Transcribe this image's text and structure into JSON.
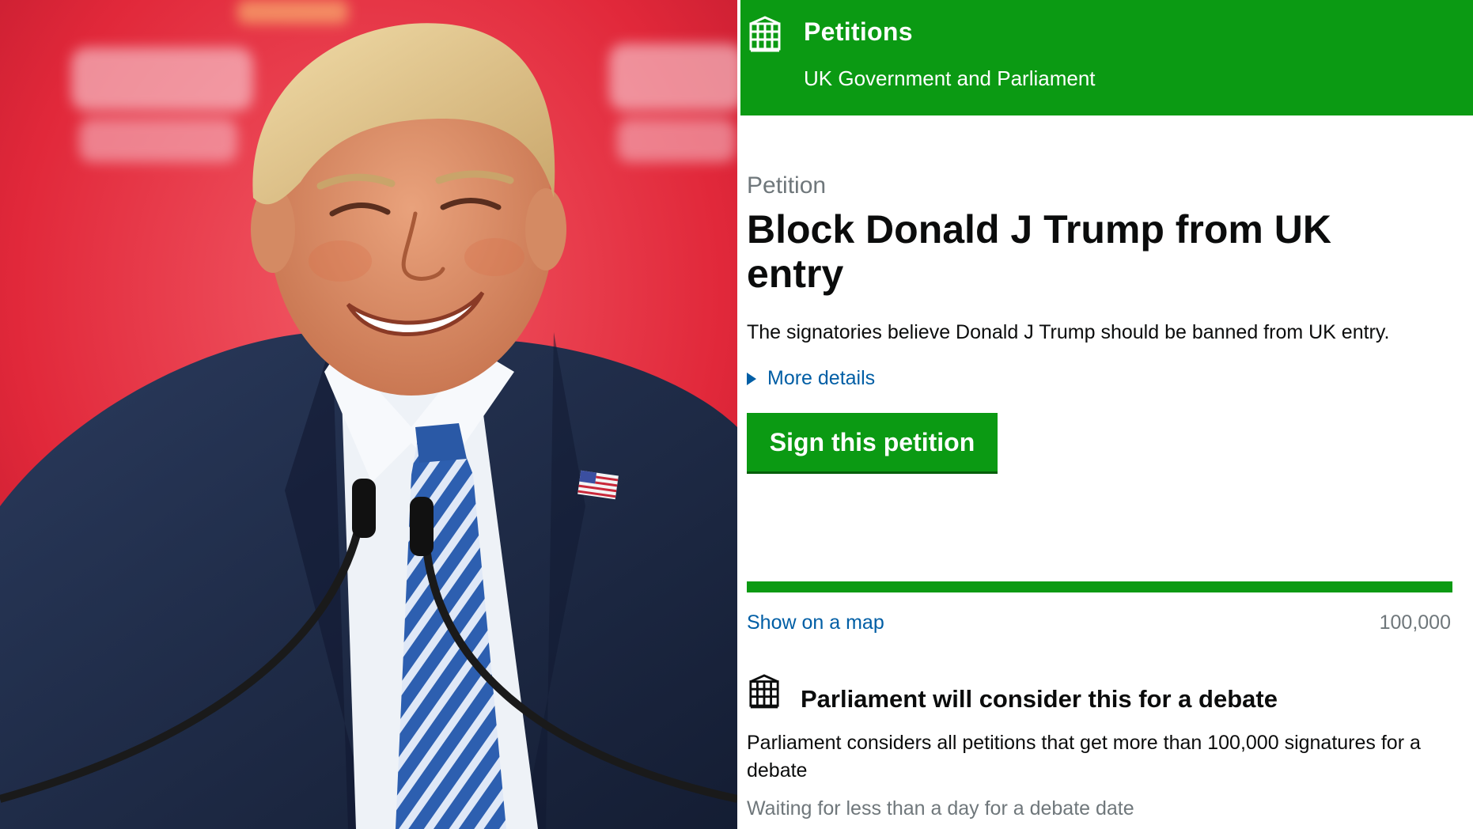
{
  "header": {
    "brand": "Petitions",
    "subbrand": "UK Government and Parliament",
    "crest_icon": "portcullis-icon"
  },
  "petition": {
    "eyebrow": "Petition",
    "title": "Block Donald J Trump from UK entry",
    "summary": "The signatories believe Donald J Trump should be banned from UK entry.",
    "more_details": "More details",
    "sign_button": "Sign this petition",
    "progress_fraction": 1.0,
    "show_on_map": "Show on a map",
    "target": "100,000"
  },
  "debate": {
    "icon": "portcullis-icon",
    "heading": "Parliament will consider this for a debate",
    "body": "Parliament considers all petitions that get more than 100,000 signatures for a debate",
    "status": "Waiting for less than a day for a debate date"
  },
  "colors": {
    "brand_green": "#0b9a13",
    "link_blue": "#005ea5",
    "muted_grey": "#6f777b",
    "photo_background_red": "#e8283a",
    "suit_navy": "#1c2a44"
  }
}
